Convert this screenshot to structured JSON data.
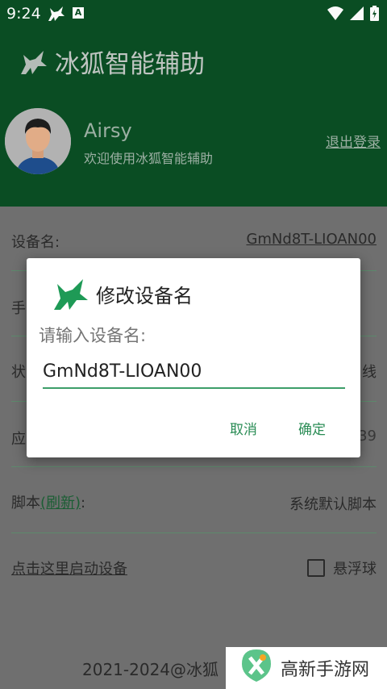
{
  "status": {
    "time": "9:24",
    "a_label": "A"
  },
  "header": {
    "app_title": "冰狐智能辅助",
    "user_name": "Airsy",
    "user_subtitle": "欢迎使用冰狐智能辅助",
    "logout": "退出登录"
  },
  "rows": {
    "device_label": "设备名:",
    "device_value": "GmNd8T-LIOAN00",
    "phone_label": "手",
    "status_label": "状",
    "status_value": "线",
    "app_label": "应",
    "app_value": "39",
    "script_label": "脚本",
    "script_refresh": "(刷新)",
    "script_colon": ":",
    "script_value": "系统默认脚本",
    "start_link": "点击这里启动设备",
    "float_ball": "悬浮球"
  },
  "footer": {
    "copyright": "2021-2024@冰狐"
  },
  "watermark": {
    "text": "高新手游网"
  },
  "dialog": {
    "title": "修改设备名",
    "prompt": "请输入设备名:",
    "input_value": "GmNd8T-LIOAN00",
    "cancel": "取消",
    "confirm": "确定"
  },
  "colors": {
    "primary": "#0a4f24",
    "accent": "#2a8c55"
  }
}
